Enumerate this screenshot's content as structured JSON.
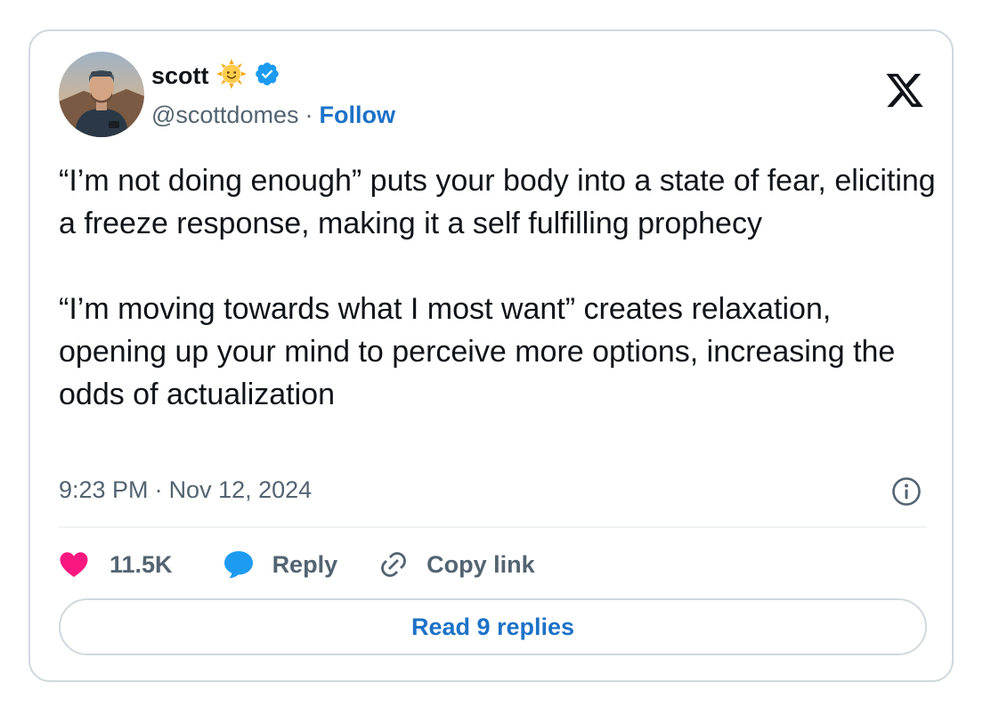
{
  "author": {
    "display_name": "scott",
    "name_emoji": "sun-with-face-emoji",
    "verified": true,
    "handle": "@scottdomes",
    "separator": "·",
    "follow_label": "Follow"
  },
  "tweet": {
    "paragraphs": [
      "“I’m not doing enough” puts your body into a state of fear, eliciting a freeze response, making it a self fulfilling prophecy",
      "“I’m moving towards what I most want” creates relaxation, opening up your mind to perceive more options, increasing the odds of actualization"
    ],
    "time": "9:23 PM",
    "separator": "·",
    "date": "Nov 12, 2024"
  },
  "actions": {
    "like_count": "11.5K",
    "reply_label": "Reply",
    "copy_link_label": "Copy link"
  },
  "read_replies_label": "Read 9 replies",
  "icons": {
    "brand": "x-logo-icon",
    "verified": "verified-badge-icon",
    "info": "info-icon",
    "like": "heart-icon",
    "reply": "reply-bubble-icon",
    "copy": "link-icon"
  },
  "colors": {
    "text": "#0f1419",
    "secondary": "#536471",
    "link": "#1d72c7",
    "verified": "#1d9bf0",
    "like": "#f91880",
    "reply": "#1d9bf0",
    "border": "#cfd9de"
  }
}
